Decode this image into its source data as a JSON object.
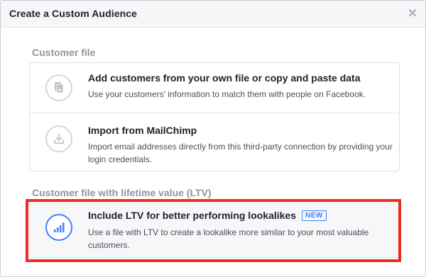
{
  "dialog": {
    "title": "Create a Custom Audience"
  },
  "customer_file": {
    "heading": "Customer file",
    "options": [
      {
        "icon": "file-add-icon",
        "title": "Add customers from your own file or copy and paste data",
        "description": "Use your customers' information to match them with people on Facebook."
      },
      {
        "icon": "import-icon",
        "title": "Import from MailChimp",
        "description": "Import email addresses directly from this third-party connection by providing your login credentials."
      }
    ]
  },
  "ltv_section": {
    "heading": "Customer file with lifetime value (LTV)",
    "option": {
      "icon": "bar-chart-icon",
      "title": "Include LTV for better performing lookalikes",
      "badge": "NEW",
      "description": "Use a file with LTV to create a lookalike more similar to your most valuable customers."
    }
  },
  "colors": {
    "accent": "#4080ff",
    "highlight": "#ee2c24",
    "muted_heading": "#90949c",
    "header_bg": "#f5f6f7"
  }
}
